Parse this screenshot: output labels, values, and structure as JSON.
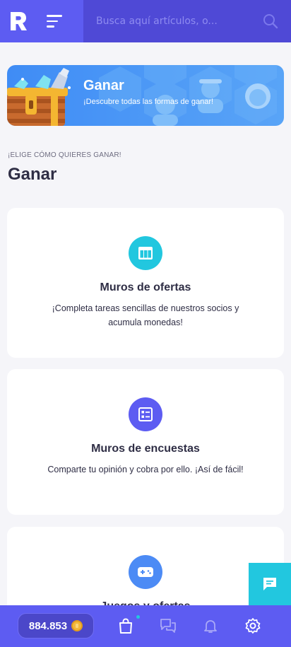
{
  "header": {
    "search_placeholder": "Busca aquí artículos, o..."
  },
  "banner": {
    "title": "Ganar",
    "subtitle": "¡Descubre todas las formas de ganar!"
  },
  "section": {
    "eyebrow": "¡ELIGE CÓMO QUIERES GANAR!",
    "title": "Ganar"
  },
  "cards": [
    {
      "icon": "table-icon",
      "title": "Muros de ofertas",
      "description": "¡Completa tareas sencillas de nuestros socios y acumula monedas!",
      "color": "#22c7df"
    },
    {
      "icon": "survey-list-icon",
      "title": "Muros de encuestas",
      "description": "Comparte tu opinión y cobra por ello. ¡Así de fácil!",
      "color": "#5d5cf2"
    },
    {
      "icon": "gamepad-icon",
      "title": "Juegos y ofertas",
      "description": "",
      "color": "#4c8bf5"
    }
  ],
  "bottom_nav": {
    "balance": "884.853",
    "items": [
      "shopping-bag-icon",
      "chat-bubbles-icon",
      "bell-icon",
      "gear-icon"
    ]
  },
  "colors": {
    "primary": "#5d5cf2",
    "primary_dark": "#4f49d6",
    "accent_cyan": "#22c7df",
    "banner_blue": "#3f8cf5",
    "coin": "#f3b73a"
  }
}
